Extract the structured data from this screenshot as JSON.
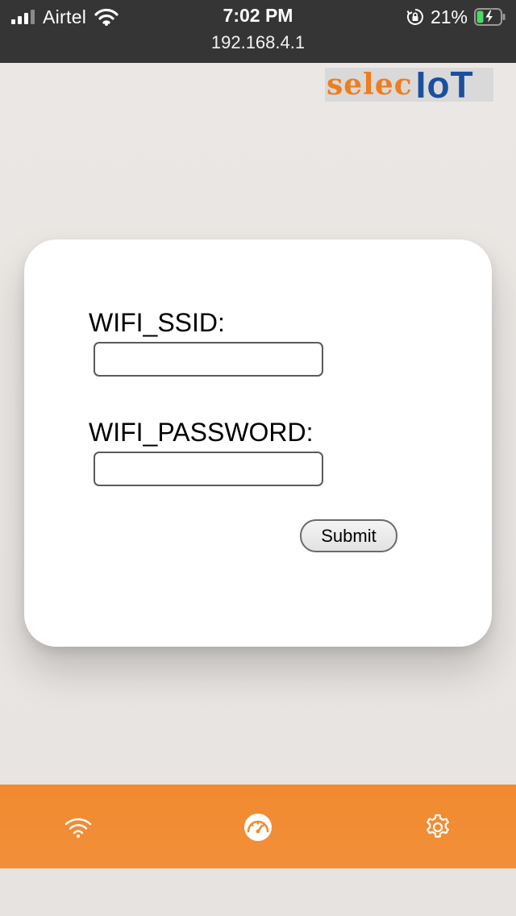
{
  "status_bar": {
    "carrier": "Airtel",
    "time": "7:02 PM",
    "url": "192.168.4.1",
    "battery_percent": "21%",
    "icons": [
      "cellular-signal-icon",
      "wifi-icon",
      "rotation-lock-icon",
      "battery-charging-icon"
    ]
  },
  "logo": {
    "part1": "selec",
    "part2": "IoT",
    "colors": {
      "part1": "#ee7d1e",
      "part2": "#1c4f9c"
    }
  },
  "form": {
    "ssid_label": "WIFI_SSID:",
    "ssid_value": "",
    "password_label": "WIFI_PASSWORD:",
    "password_value": "",
    "submit_label": "Submit"
  },
  "bottom_nav": {
    "accent_color": "#f08a30",
    "items": [
      {
        "icon": "wifi-icon"
      },
      {
        "icon": "dashboard-gauge-icon"
      },
      {
        "icon": "settings-gear-icon"
      }
    ]
  }
}
